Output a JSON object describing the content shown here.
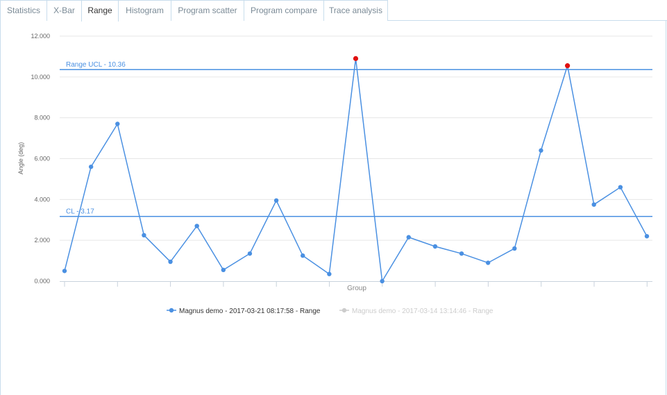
{
  "tabs": [
    {
      "label": "Statistics",
      "active": false
    },
    {
      "label": "X-Bar",
      "active": false
    },
    {
      "label": "Range",
      "active": true
    },
    {
      "label": "Histogram",
      "active": false
    },
    {
      "label": "Program scatter",
      "active": false
    },
    {
      "label": "Program compare",
      "active": false
    },
    {
      "label": "Trace analysis",
      "active": false
    }
  ],
  "chart_data": {
    "type": "line",
    "xlabel": "Group",
    "ylabel": "Angle (deg)",
    "ylim": [
      0,
      12
    ],
    "yticks": [
      "0.000",
      "2.000",
      "4.000",
      "6.000",
      "8.000",
      "10.000",
      "12.000"
    ],
    "grid": true,
    "legend_placement": "bottom",
    "control_lines": [
      {
        "label": "Range UCL - 10.36",
        "value": 10.36
      },
      {
        "label": "CL - 3.17",
        "value": 3.17
      }
    ],
    "series": [
      {
        "name": "Magnus demo - 2017-03-21 08:17:58 - Range",
        "color": "#4a90e2",
        "visible": true,
        "values": [
          0.5,
          5.6,
          7.7,
          2.25,
          0.95,
          2.7,
          0.55,
          1.35,
          3.95,
          1.25,
          0.35,
          10.9,
          0.0,
          2.15,
          1.7,
          1.35,
          0.9,
          1.6,
          6.4,
          10.55,
          3.75,
          4.6,
          2.2
        ],
        "out_of_control_indices": [
          11,
          19
        ],
        "out_of_control_color": "#e01010"
      },
      {
        "name": "Magnus demo - 2017-03-14 13:14:46 - Range",
        "color": "#cccccc",
        "visible": false,
        "values": []
      }
    ]
  }
}
